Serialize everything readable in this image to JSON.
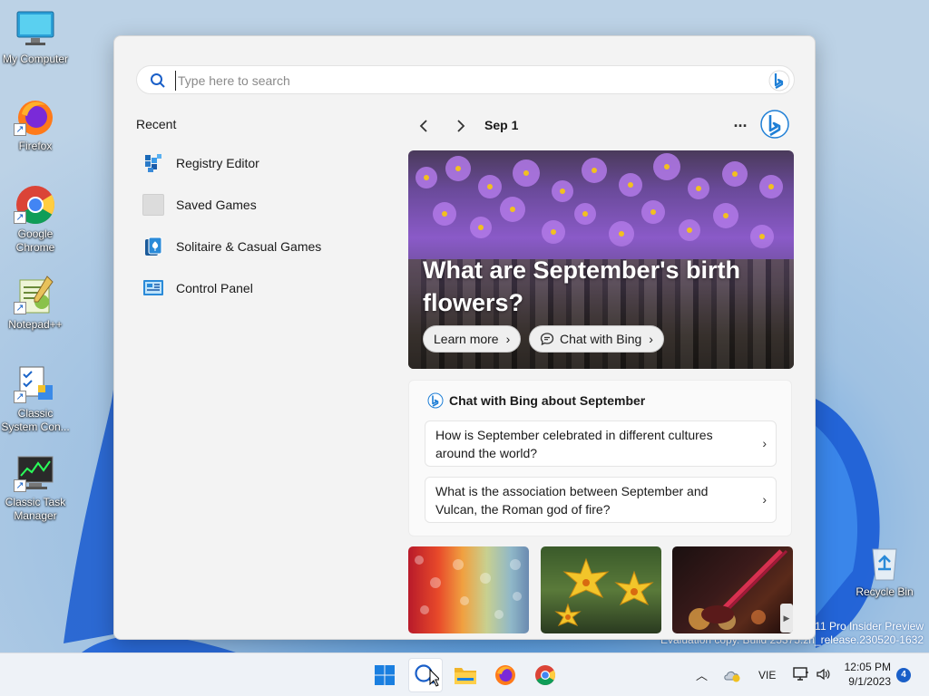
{
  "desktop": {
    "icons": [
      {
        "label": "My Computer"
      },
      {
        "label": "Firefox"
      },
      {
        "label": "Google Chrome"
      },
      {
        "label": "Notepad++"
      },
      {
        "label": "Classic System Con..."
      },
      {
        "label": "Classic Task Manager"
      },
      {
        "label": "Recycle Bin"
      }
    ],
    "watermark_line1": "11 Pro Insider Preview",
    "watermark_line2": "Evaluation copy. Build 25375.zn_release.230520-1632"
  },
  "search": {
    "placeholder": "Type here to search",
    "value": ""
  },
  "recent": {
    "title": "Recent",
    "items": [
      {
        "label": "Registry Editor",
        "icon": "registry-editor-icon"
      },
      {
        "label": "Saved Games",
        "icon": "saved-games-icon"
      },
      {
        "label": "Solitaire & Casual Games",
        "icon": "solitaire-icon"
      },
      {
        "label": "Control Panel",
        "icon": "control-panel-icon"
      }
    ]
  },
  "highlights": {
    "date": "Sep 1",
    "more": "...",
    "hero": {
      "title": "What are September's birth flowers?",
      "learn_more": "Learn more",
      "chat": "Chat with Bing"
    },
    "chat_card": {
      "title": "Chat with Bing about September",
      "questions": [
        {
          "text": "How is September celebrated in different cultures around the world?"
        },
        {
          "text": "What is the association between September and Vulcan, the Roman god of fire?"
        }
      ]
    }
  },
  "taskbar": {
    "language": "VIE",
    "time": "12:05 PM",
    "date": "9/1/2023",
    "notifications": "4"
  },
  "colors": {
    "accent": "#1a5fc8",
    "bing": "#1f7fd6",
    "panel": "#f3f3f3"
  }
}
